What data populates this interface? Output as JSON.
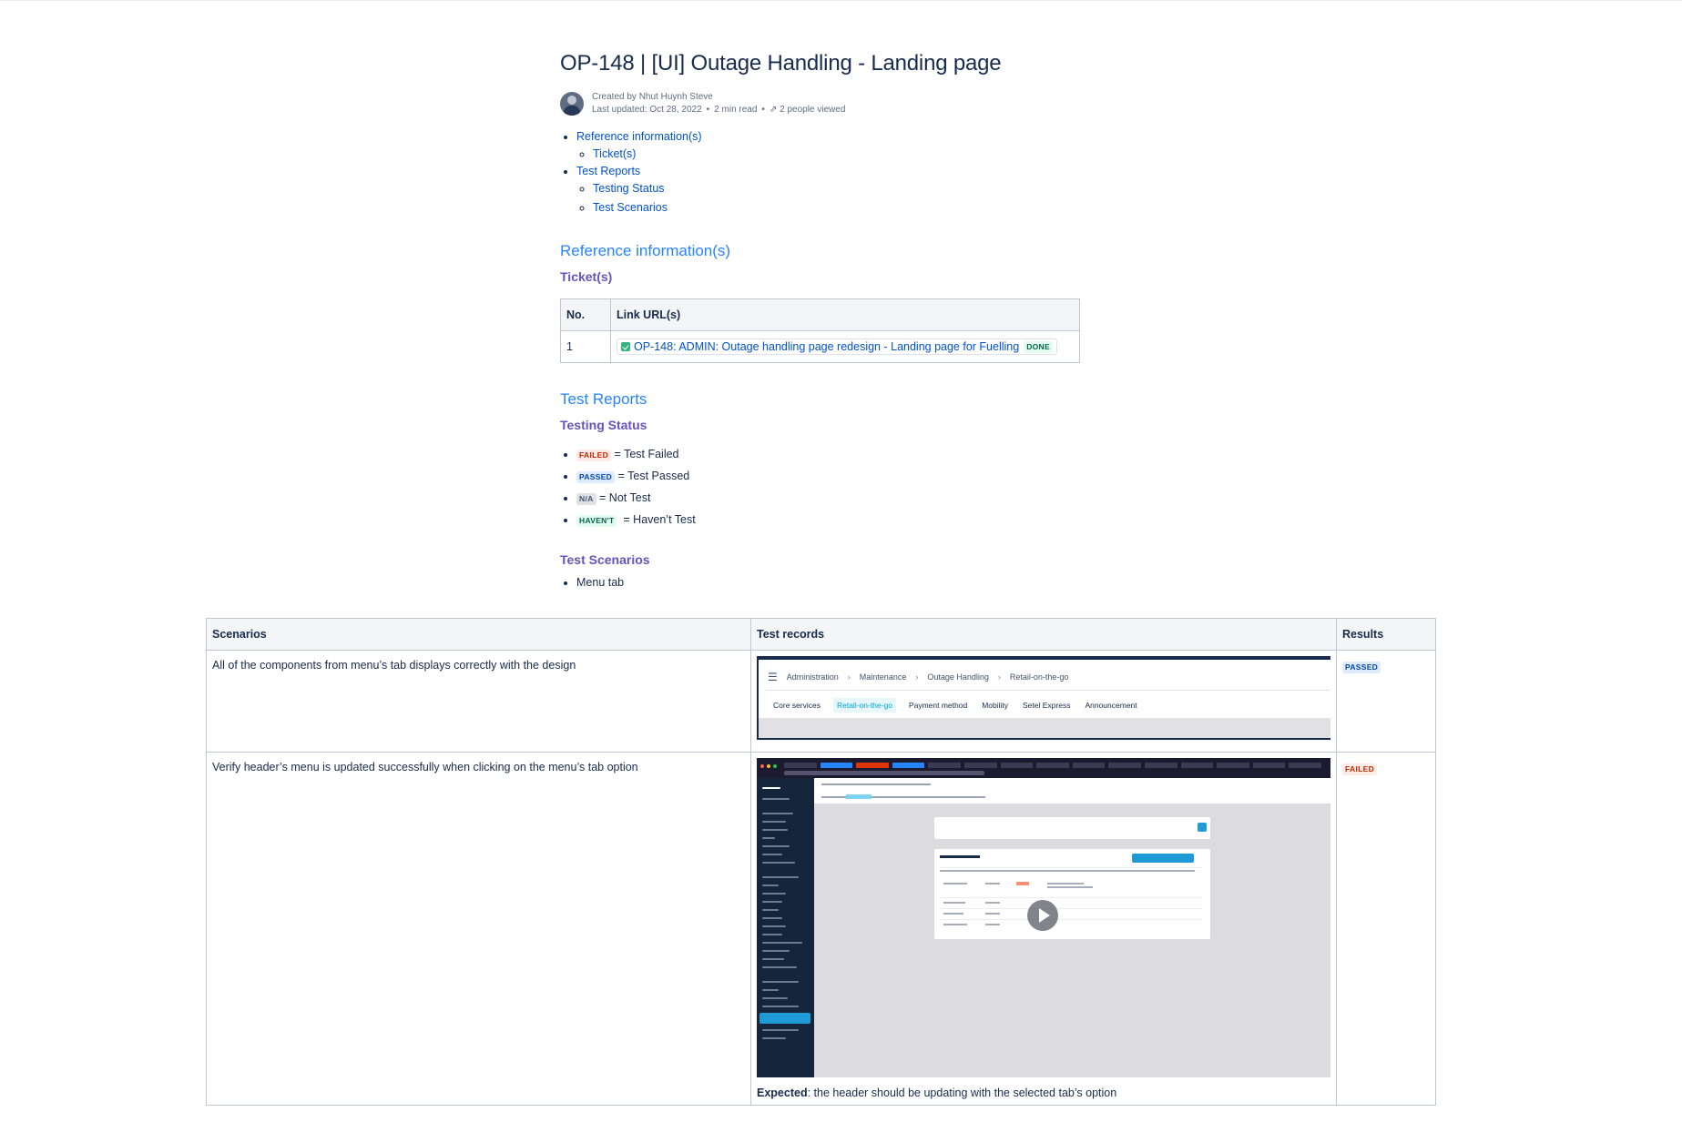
{
  "page": {
    "title": "OP-148 | [UI] Outage Handling - Landing page",
    "created_by": "Created by Nhut Huynh Steve",
    "last_updated": "Last updated: Oct 28, 2022",
    "read_time": "2 min read",
    "views": "2 people viewed"
  },
  "toc": [
    {
      "label": "Reference information(s)",
      "children": [
        "Ticket(s)"
      ]
    },
    {
      "label": "Test Reports",
      "children": [
        "Testing Status",
        "Test Scenarios"
      ]
    }
  ],
  "reference": {
    "heading": "Reference information(s)",
    "subheading": "Ticket(s)",
    "table": {
      "headers": [
        "No.",
        "Link URL(s)"
      ],
      "rows": [
        {
          "no": "1",
          "link": "OP-148: ADMIN: Outage handling page redesign - Landing page for Fuelling",
          "status": "DONE"
        }
      ]
    }
  },
  "reports": {
    "heading": "Test Reports",
    "status_heading": "Testing Status",
    "legend": [
      {
        "badge": "FAILED",
        "text": "= Test Failed"
      },
      {
        "badge": "PASSED",
        "text": "= Test Passed"
      },
      {
        "badge": "N/A",
        "text": "= Not Test"
      },
      {
        "badge": "HAVEN'T",
        "text": "= Haven’t Test"
      }
    ],
    "scenarios_heading": "Test Scenarios",
    "scenario_list": [
      "Menu tab"
    ]
  },
  "scenarios_table": {
    "headers": [
      "Scenarios",
      "Test records",
      "Results"
    ],
    "rows": [
      {
        "scenario": "All of the components from menu’s tab displays correctly with the design",
        "result": "PASSED",
        "screenshot": {
          "breadcrumbs": [
            "Administration",
            "Maintenance",
            "Outage Handling",
            "Retail-on-the-go"
          ],
          "tabs": [
            "Core services",
            "Retail-on-the-go",
            "Payment method",
            "Mobility",
            "Setel Express",
            "Announcement"
          ],
          "active_tab": "Retail-on-the-go"
        }
      },
      {
        "scenario": "Verify header’s menu is updated successfully when clicking on the menu’s tab option",
        "result": "FAILED",
        "expected_label": "Expected",
        "expected_text": ": the header should be updating with the selected tab’s option"
      }
    ]
  },
  "colors": {
    "link": "#0052cc",
    "h2": "#2684ff",
    "h3": "#6554c0",
    "failed": "#bf2600",
    "passed": "#0747a6",
    "done": "#006644"
  }
}
